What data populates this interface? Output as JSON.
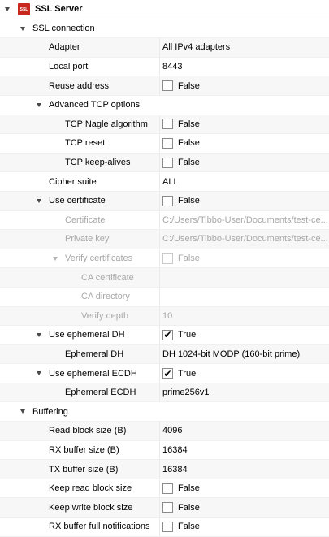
{
  "server": {
    "icon": "ssl-icon",
    "icon_text": "SSL",
    "title": "SSL Server"
  },
  "ssl_connection": {
    "label": "SSL connection",
    "adapter": {
      "label": "Adapter",
      "value": "All IPv4 adapters"
    },
    "local_port": {
      "label": "Local port",
      "value": "8443"
    },
    "reuse_address": {
      "label": "Reuse address",
      "value": "False"
    },
    "advanced_tcp": {
      "label": "Advanced TCP options",
      "nagle": {
        "label": "TCP Nagle algorithm",
        "value": "False"
      },
      "reset": {
        "label": "TCP reset",
        "value": "False"
      },
      "keepalives": {
        "label": "TCP keep-alives",
        "value": "False"
      }
    },
    "cipher_suite": {
      "label": "Cipher suite",
      "value": "ALL"
    },
    "use_certificate": {
      "label": "Use certificate",
      "value": "False",
      "certificate": {
        "label": "Certificate",
        "value": "C:/Users/Tibbo-User/Documents/test-ce..."
      },
      "private_key": {
        "label": "Private key",
        "value": "C:/Users/Tibbo-User/Documents/test-ce..."
      },
      "verify": {
        "label": "Verify certificates",
        "value": "False",
        "ca_certificate": {
          "label": "CA certificate",
          "value": ""
        },
        "ca_directory": {
          "label": "CA directory",
          "value": ""
        },
        "verify_depth": {
          "label": "Verify depth",
          "value": "10"
        }
      }
    },
    "ephemeral_dh": {
      "label": "Use ephemeral DH",
      "value": "True",
      "dh": {
        "label": "Ephemeral DH",
        "value": "DH 1024-bit MODP (160-bit prime)"
      }
    },
    "ephemeral_ecdh": {
      "label": "Use ephemeral ECDH",
      "value": "True",
      "ecdh": {
        "label": "Ephemeral ECDH",
        "value": "prime256v1"
      }
    }
  },
  "buffering": {
    "label": "Buffering",
    "read_block": {
      "label": "Read block size (B)",
      "value": "4096"
    },
    "rx_buffer": {
      "label": "RX buffer size (B)",
      "value": "16384"
    },
    "tx_buffer": {
      "label": "TX buffer size (B)",
      "value": "16384"
    },
    "keep_read": {
      "label": "Keep read block size",
      "value": "False"
    },
    "keep_write": {
      "label": "Keep write block size",
      "value": "False"
    },
    "rx_full_notify": {
      "label": "RX buffer full notifications",
      "value": "False"
    }
  },
  "checkbox_mark": "✔"
}
